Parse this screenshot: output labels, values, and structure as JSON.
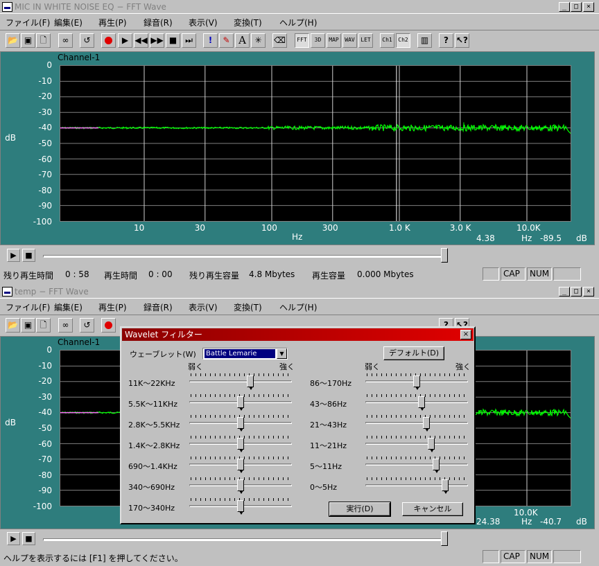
{
  "window1": {
    "title": "MIC IN WHITE NOISE EQ − FFT Wave",
    "menu": [
      "ファイル(F)",
      "編集(E)",
      "再生(P)",
      "録音(R)",
      "表示(V)",
      "変換(T)",
      "ヘルプ(H)"
    ],
    "channel": "Channel-1",
    "y_ticks": [
      "0",
      "-10",
      "-20",
      "-30",
      "-40",
      "-50",
      "-60",
      "-70",
      "-80",
      "-90",
      "-100"
    ],
    "y_unit": "dB",
    "x_ticks": [
      "10",
      "30",
      "100",
      "300",
      "1.0 K",
      "3.0 K",
      "10.0K"
    ],
    "x_unit": "Hz",
    "readout_value": "4.38",
    "readout_hz": "Hz",
    "readout_db": "-89.5",
    "readout_db_unit": "dB",
    "status": {
      "remaining_time_label": "残り再生時間",
      "remaining_time": "0 : 58",
      "play_time_label": "再生時間",
      "play_time": "0 : 00",
      "remaining_capacity_label": "残り再生容量",
      "remaining_capacity": "4.8 Mbytes",
      "capacity_label": "再生容量",
      "capacity": "0.000 Mbytes",
      "cap": "CAP",
      "num": "NUM"
    }
  },
  "window2": {
    "title": "temp − FFT Wave",
    "menu": [
      "ファイル(F)",
      "編集(E)",
      "再生(P)",
      "録音(R)",
      "表示(V)",
      "変換(T)",
      "ヘルプ(H)"
    ],
    "channel": "Channel-1",
    "y_ticks": [
      "0",
      "-10",
      "-20",
      "-30",
      "-40",
      "-50",
      "-60",
      "-70",
      "-80",
      "-90",
      "-100"
    ],
    "y_unit": "dB",
    "x_tick_visible": "10.0K",
    "readout_value": "24.38",
    "readout_hz": "Hz",
    "readout_db": "-40.7",
    "readout_db_unit": "dB",
    "status": {
      "help": "ヘルプを表示するには [F1] を押してください。",
      "cap": "CAP",
      "num": "NUM"
    }
  },
  "toolbar": {
    "fft": "FFT",
    "d3": "3D",
    "map": "MAP",
    "wav": "WAV",
    "let": "LET",
    "ch1": "Ch1",
    "ch2": "Ch2"
  },
  "dialog": {
    "title": "Wavelet フィルター",
    "wavelet_label": "ウェーブレット(W)",
    "wavelet_value": "Battle Lemarie",
    "default_button": "デフォルト(D)",
    "weak": "弱く",
    "strong": "強く",
    "left_bands": [
      {
        "label": "11K〜22KHz",
        "level": 0.6
      },
      {
        "label": "5.5K〜11KHz",
        "level": 0.5
      },
      {
        "label": "2.8K〜5.5KHz",
        "level": 0.5
      },
      {
        "label": "1.4K〜2.8KHz",
        "level": 0.5
      },
      {
        "label": "690〜1.4KHz",
        "level": 0.5
      },
      {
        "label": "340〜690Hz",
        "level": 0.5
      },
      {
        "label": "170〜340Hz",
        "level": 0.5
      }
    ],
    "right_bands": [
      {
        "label": "86〜170Hz",
        "level": 0.5
      },
      {
        "label": "43〜86Hz",
        "level": 0.55
      },
      {
        "label": "21〜43Hz",
        "level": 0.6
      },
      {
        "label": "11〜21Hz",
        "level": 0.65
      },
      {
        "label": "5〜11Hz",
        "level": 0.7
      },
      {
        "label": "0〜5Hz",
        "level": 0.8
      }
    ],
    "run_button": "実行(D)",
    "cancel_button": "キャンセル"
  },
  "colors": {
    "plot_bg": "#000000",
    "panel": "#2e7d7d",
    "trace": "#00ff00",
    "dialog_title": "#c00000"
  }
}
